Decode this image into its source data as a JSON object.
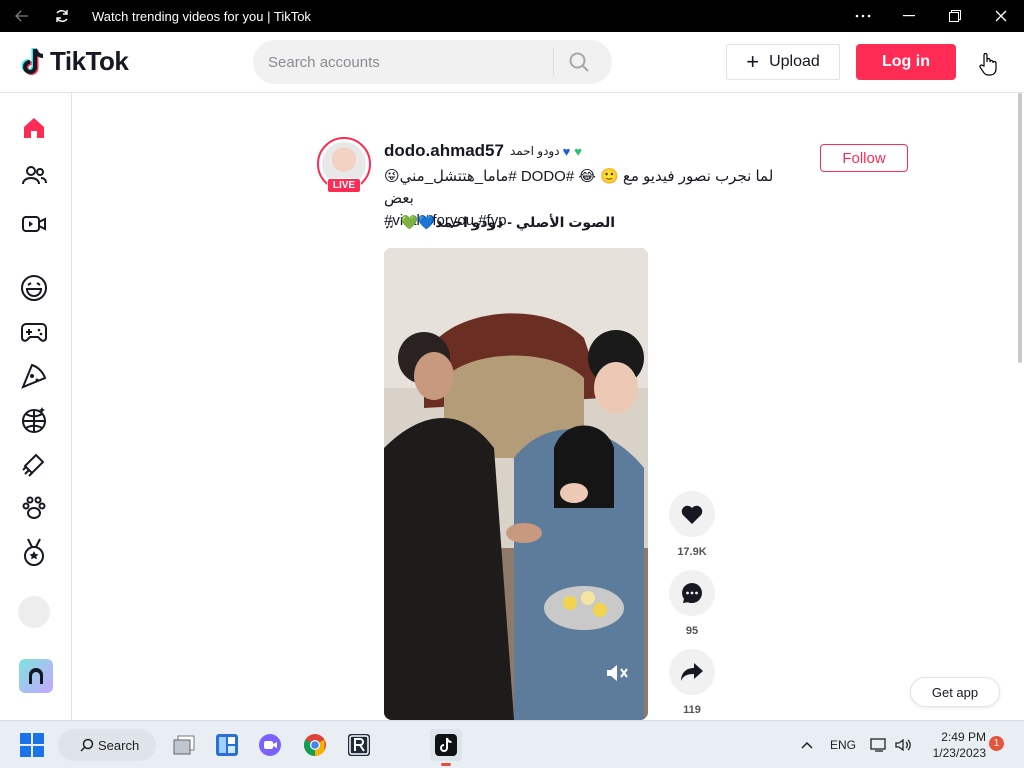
{
  "window": {
    "title": "Watch trending videos for you | TikTok"
  },
  "header": {
    "logo_text": "TikTok",
    "search_placeholder": "Search accounts",
    "upload_label": "Upload",
    "login_label": "Log in"
  },
  "sidebar": {
    "items": [
      {
        "icon": "home-icon",
        "active": true
      },
      {
        "icon": "following-icon"
      },
      {
        "icon": "live-icon"
      },
      {
        "icon": "comedy-icon"
      },
      {
        "icon": "gaming-icon"
      },
      {
        "icon": "food-icon"
      },
      {
        "icon": "dance-icon"
      },
      {
        "icon": "beauty-icon"
      },
      {
        "icon": "animals-icon"
      },
      {
        "icon": "sports-icon"
      }
    ]
  },
  "post": {
    "username": "dodo.ahmad57",
    "nickname": "دودو احمد",
    "live_badge": "LIVE",
    "caption_line1": "😜ماما_هتتشل_مني# DODO# 😂 🙂 لما نجرب نصور فيديو مع بعض",
    "caption_line2": "#viral #foryou #fyp",
    "music": "💚💙الصوت الأصلي - دودو احمد",
    "follow_label": "Follow",
    "likes": "17.9K",
    "comments": "95",
    "shares": "119"
  },
  "get_app_label": "Get app",
  "taskbar": {
    "search_label": "Search",
    "language": "ENG",
    "time": "2:49 PM",
    "date": "1/23/2023",
    "notification_count": "1"
  },
  "colors": {
    "brand": "#fe2c55",
    "text": "#161823"
  }
}
